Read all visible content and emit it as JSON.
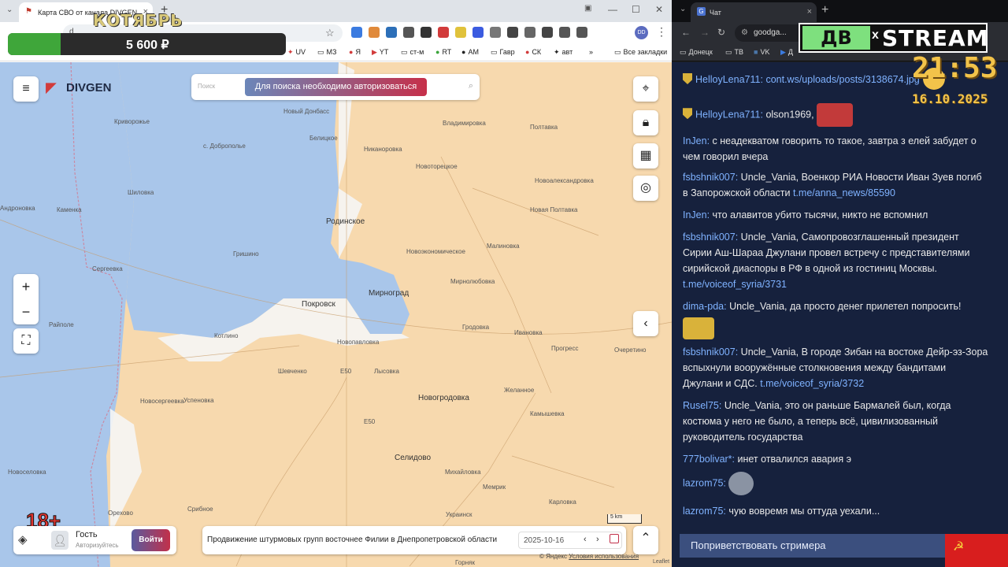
{
  "left_browser": {
    "tab_title": "Карта СВО от канала DIVGEN",
    "address_prefix": "d",
    "bookmarks": [
      "UV",
      "МЗ",
      "Я",
      "YT",
      "ст-м",
      "RT",
      "AM",
      "Гавр",
      "СК",
      "авт",
      "Все закладки"
    ],
    "bookmark_chevron": "»",
    "profile": "DD"
  },
  "promo": {
    "title": "КОТЯБРЬ",
    "amount": "5 600 ₽",
    "progress_fraction": 0.19,
    "fill_color": "#3fa63a"
  },
  "map": {
    "logo": "DIVGEN",
    "search_placeholder": "Поиск",
    "search_auth_label": "Для поиска необходимо авторизоваться",
    "zoom_in": "+",
    "zoom_out": "−",
    "scale_label": "5 km",
    "age_rating": "18+",
    "guest_name": "Гость",
    "guest_status": "Авторизуйтесь",
    "login_label": "Войти",
    "news_text": "Продвижение штурмовых групп восточнее Филии в Днепропетровской области",
    "date_value": "2025-10-16",
    "credits_prefix": "© Яндекс",
    "credits_link": "Условия использования",
    "leaflet": "Leaflet",
    "cities": [
      {
        "name": "Криворожье",
        "cls": ""
      },
      {
        "name": "Новый Донбасс",
        "cls": ""
      },
      {
        "name": "Владимировка",
        "cls": ""
      },
      {
        "name": "Полтавка",
        "cls": ""
      },
      {
        "name": "Белицкое",
        "cls": ""
      },
      {
        "name": "с. Доброполье",
        "cls": ""
      },
      {
        "name": "Никаноровка",
        "cls": ""
      },
      {
        "name": "Новоторецкое",
        "cls": ""
      },
      {
        "name": "Новоалександровка",
        "cls": ""
      },
      {
        "name": "Шиловка",
        "cls": ""
      },
      {
        "name": "Каменка",
        "cls": ""
      },
      {
        "name": "Андроновка",
        "cls": ""
      },
      {
        "name": "Родинское",
        "cls": "big"
      },
      {
        "name": "Новая Полтавка",
        "cls": ""
      },
      {
        "name": "Гришино",
        "cls": ""
      },
      {
        "name": "Новоэкономическое",
        "cls": ""
      },
      {
        "name": "Малиновка",
        "cls": ""
      },
      {
        "name": "Сергеевка",
        "cls": ""
      },
      {
        "name": "Мирнолюбовка",
        "cls": ""
      },
      {
        "name": "Покровск",
        "cls": "big"
      },
      {
        "name": "Мирноград",
        "cls": "big"
      },
      {
        "name": "Райполе",
        "cls": ""
      },
      {
        "name": "Гродовка",
        "cls": ""
      },
      {
        "name": "Ивановка",
        "cls": ""
      },
      {
        "name": "Котлино",
        "cls": ""
      },
      {
        "name": "Новопавловка",
        "cls": ""
      },
      {
        "name": "Прогресс",
        "cls": ""
      },
      {
        "name": "Очеретино",
        "cls": ""
      },
      {
        "name": "Шевченко",
        "cls": ""
      },
      {
        "name": "Лысовка",
        "cls": ""
      },
      {
        "name": "Новосергеевка",
        "cls": ""
      },
      {
        "name": "Успеновка",
        "cls": ""
      },
      {
        "name": "Новогродовка",
        "cls": "big"
      },
      {
        "name": "Желанное",
        "cls": ""
      },
      {
        "name": "Камышевка",
        "cls": ""
      },
      {
        "name": "Селидово",
        "cls": "big"
      },
      {
        "name": "Михайловка",
        "cls": ""
      },
      {
        "name": "Новоселовка",
        "cls": ""
      },
      {
        "name": "Мемрик",
        "cls": ""
      },
      {
        "name": "Карловка",
        "cls": ""
      },
      {
        "name": "Орехово",
        "cls": ""
      },
      {
        "name": "Срибное",
        "cls": ""
      },
      {
        "name": "Украинск",
        "cls": ""
      },
      {
        "name": "Горняк",
        "cls": ""
      },
      {
        "name": "Е50",
        "cls": ""
      },
      {
        "name": "Е50",
        "cls": ""
      }
    ]
  },
  "right_browser": {
    "tab_title": "Чат",
    "address": "goodga...",
    "bookmarks": [
      "Донецк",
      "ТВ",
      "VK",
      "Д"
    ]
  },
  "stream": {
    "logo_left": "ДВ",
    "logo_x": "x",
    "logo_right": "STREAM",
    "clock_time": "21:53",
    "clock_date": "16.10.2025"
  },
  "chat": {
    "messages": [
      {
        "nick": "HelloyLena711",
        "badge": true,
        "text": "",
        "link": "cont.ws/uploads/posts/3138674.jpg"
      },
      {
        "nick": "HelloyLena711",
        "badge": true,
        "text": "olson1969,",
        "link": "",
        "emote": "bird"
      },
      {
        "nick": "InJen",
        "badge": false,
        "text": "с неадекватом говорить то такое, завтра з елей забудет о чем говорил вчера",
        "link": ""
      },
      {
        "nick": "fsbshnik007",
        "badge": false,
        "text": "Uncle_Vania, Военкор РИА Новости Иван Зуев погиб в Запорожской области",
        "link": "t.me/anna_news/85590"
      },
      {
        "nick": "InJen",
        "badge": false,
        "text": "что алавитов убито тысячи, никто не вспомнил",
        "link": ""
      },
      {
        "nick": "fsbshnik007",
        "badge": false,
        "text": "Uncle_Vania, Самопровозглашенный президент Сирии Аш-Шараа Джулани провел встречу с представителями сирийской диаспоры в РФ в одной из гостиниц Москвы.",
        "link": "t.me/voiceof_syria/3731"
      },
      {
        "nick": "dima-pda",
        "badge": false,
        "text": "Uncle_Vania, да просто денег прилетел попросить!",
        "link": "",
        "emote": "pair"
      },
      {
        "nick": "fsbshnik007",
        "badge": false,
        "text": "Uncle_Vania, В городе Зибан на востоке Дейр-эз-Зора вспыхнули вооружённые столкновения между бандитами Джулани и СДС.",
        "link": "t.me/voiceof_syria/3732"
      },
      {
        "nick": "Rusel75",
        "badge": false,
        "text": "Uncle_Vania, это он раньше Бармалей был, когда костюма у него не было, а теперь всё, цивилизованный руководитель государства",
        "link": ""
      },
      {
        "nick": "777bolivar*",
        "badge": false,
        "text": "инет отвалился авария э",
        "link": ""
      },
      {
        "nick": "lazrom75",
        "badge": false,
        "text": "",
        "link": "",
        "emote": "shrug"
      },
      {
        "nick": "lazrom75",
        "badge": false,
        "text": "чую вовремя мы оттуда уехали...",
        "link": ""
      }
    ],
    "greet_label": "Поприветствовать стримера",
    "flag_symbol": "☭"
  }
}
